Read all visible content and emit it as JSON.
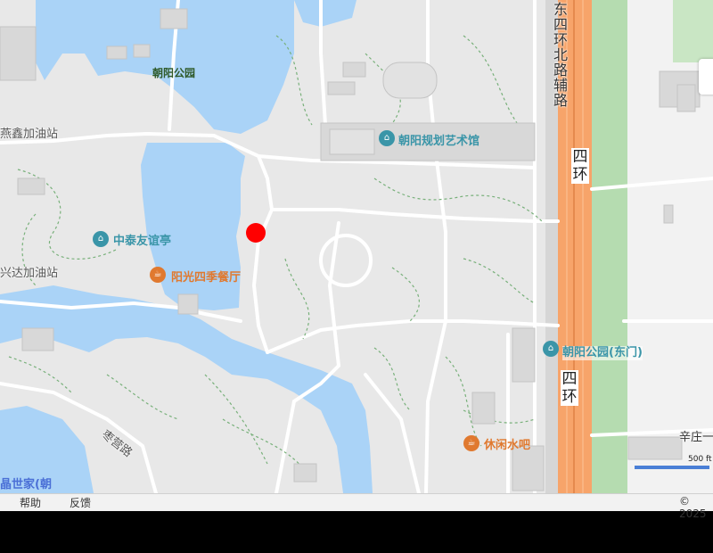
{
  "map": {
    "labels": {
      "park": "朝阳公园",
      "fuel_north": "燕鑫加油站",
      "fuel_west": "兴达加油站",
      "museum": "朝阳规划艺术馆",
      "pavilion": "中泰友谊亭",
      "restaurant": "阳光四季餐厅",
      "park_east_gate": "朝阳公园(东门)",
      "bar": "休闲水吧",
      "road_east4_ring_north_aux": [
        "东",
        "四",
        "环",
        "北",
        "路",
        "辅",
        "路"
      ],
      "ring_top": [
        "四",
        "环"
      ],
      "ring_bottom": [
        "四",
        "环"
      ],
      "road_zaoying": "枣营路",
      "road_xinzhuang": "辛庄一",
      "building_bottom_left": "晶世家(朝"
    },
    "icons": {
      "museum_icon": "museum-icon",
      "restaurant_icon": "restaurant-icon",
      "marker": "red-location-marker"
    },
    "scale": {
      "label": "500 ft"
    },
    "colors": {
      "water": "#aad3f7",
      "park_ground": "#e8e8e8",
      "highway": "#f7a46a",
      "green_strip": "#b5dcb0",
      "poi_teal": "#3a95a8",
      "food_orange": "#e0792f",
      "marker_red": "#ff0000"
    }
  },
  "footer": {
    "help": "帮助",
    "feedback": "反馈",
    "copyright": "© 2025"
  }
}
